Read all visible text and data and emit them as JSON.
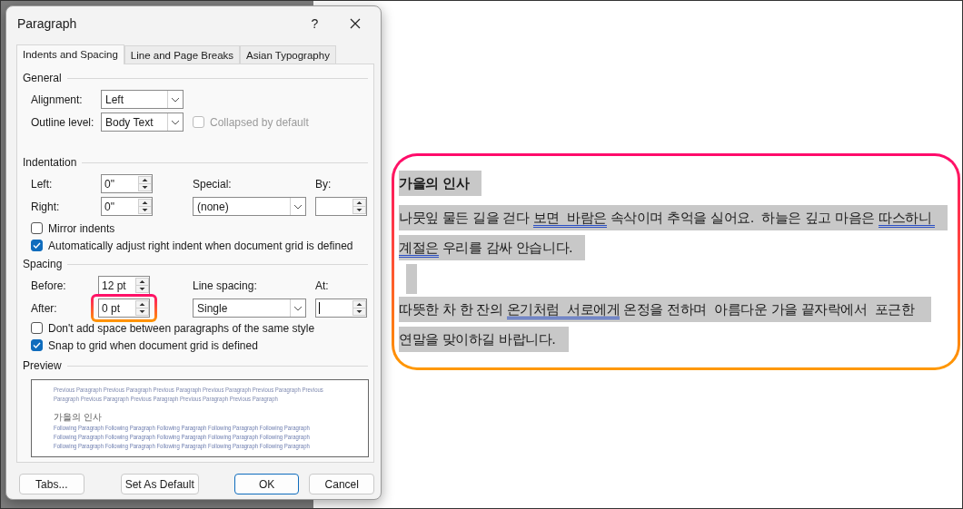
{
  "dialog": {
    "title": "Paragraph",
    "help": "?"
  },
  "tabs": [
    {
      "label": "Indents and Spacing",
      "selected": true
    },
    {
      "label": "Line and Page Breaks",
      "selected": false
    },
    {
      "label": "Asian Typography",
      "selected": false
    }
  ],
  "general": {
    "heading": "General",
    "alignment": {
      "label": "Alignment:",
      "value": "Left"
    },
    "outline_level": {
      "label": "Outline level:",
      "value": "Body Text"
    },
    "collapsed": {
      "label": "Collapsed by default",
      "checked": false,
      "disabled": true
    }
  },
  "indentation": {
    "heading": "Indentation",
    "left": {
      "label": "Left:",
      "value": "0\""
    },
    "right": {
      "label": "Right:",
      "value": "0\""
    },
    "special": {
      "label": "Special:",
      "value": "(none)"
    },
    "by": {
      "label": "By:"
    },
    "mirror": {
      "label": "Mirror indents",
      "checked": false,
      "disabled": false
    },
    "auto_adjust": {
      "label": "Automatically adjust right indent when document grid is defined",
      "checked": true,
      "disabled": false
    }
  },
  "spacing": {
    "heading": "Spacing",
    "before": {
      "label": "Before:",
      "value": "12 pt",
      "highlighted": false
    },
    "after": {
      "label": "After:",
      "value": "0 pt",
      "highlighted": true
    },
    "line_spacing": {
      "label": "Line spacing:",
      "value": "Single"
    },
    "at": {
      "label": "At:",
      "focused": true
    },
    "dont_add": {
      "label": "Don't add space between paragraphs of the same style",
      "checked": false,
      "disabled": false
    },
    "snap": {
      "label": "Snap to grid when document grid is defined",
      "checked": true,
      "disabled": false
    }
  },
  "preview": {
    "heading": "Preview",
    "previous_lines": [
      "Previous Paragraph Previous Paragraph Previous Paragraph Previous Paragraph Previous Paragraph Previous",
      "Paragraph Previous Paragraph Previous Paragraph Previous Paragraph Previous Paragraph"
    ],
    "current": "가을의 인사",
    "following_lines": [
      "Following Paragraph Following Paragraph Following Paragraph Following Paragraph Following Paragraph",
      "Following Paragraph Following Paragraph Following Paragraph Following Paragraph Following Paragraph",
      "Following Paragraph Following Paragraph Following Paragraph Following Paragraph Following Paragraph"
    ]
  },
  "buttons": [
    {
      "label": "Tabs...",
      "default": false
    },
    {
      "label": "Set As Default",
      "default": false
    },
    {
      "label": "OK",
      "default": true
    },
    {
      "label": "Cancel",
      "default": false
    }
  ],
  "document": {
    "highlighted": true,
    "paragraphs": [
      {
        "kind": "heading",
        "selected": true,
        "segments": [
          {
            "text": "가을의 인사",
            "flagged": false
          }
        ]
      },
      {
        "kind": "body",
        "selected": true,
        "segments": [
          {
            "text": "나뭇잎 물든 길을 걷다 ",
            "flagged": false
          },
          {
            "text": "보면  바람은",
            "flagged": true
          },
          {
            "text": " 속삭이며 추억을 실어요.  하늘은 깊고 마음은 ",
            "flagged": false
          },
          {
            "text": "따스하니 ",
            "flagged": true
          },
          {
            "text": "계절은",
            "flagged": true
          },
          {
            "text": " 우리를 감싸 안습니다.",
            "flagged": false
          }
        ]
      },
      {
        "kind": "empty",
        "selected": true
      },
      {
        "kind": "body",
        "selected": true,
        "segments": [
          {
            "text": "따뜻한 차 한 잔의 ",
            "flagged": false
          },
          {
            "text": "온기처럼  서로에게",
            "flagged": true
          },
          {
            "text": " 온정을 전하며  아름다운 가을 끝자락에서  포근한 연말을 맞이하길 바랍니다.",
            "flagged": false
          }
        ]
      }
    ]
  }
}
